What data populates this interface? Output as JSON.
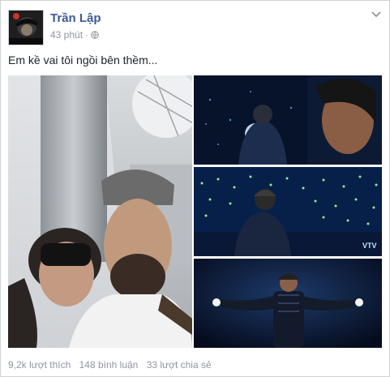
{
  "post": {
    "author": "Trần Lập",
    "time": "43 phút",
    "separator": "·",
    "caption": "Em kề vai tôi ngồi bên thềm...",
    "privacy_icon": "globe-icon",
    "menu_icon": "chevron-down-icon"
  },
  "photos": {
    "watermark": "VTV"
  },
  "stats": {
    "likes": "9,2k lượt thích",
    "comments": "148 bình luận",
    "shares": "33 lượt chia sẻ"
  },
  "colors": {
    "author": "#3b5998",
    "meta": "#90949c",
    "text": "#1d2129",
    "stage_blue": "#0a1a3a",
    "crowd_light": "#7df07a"
  }
}
